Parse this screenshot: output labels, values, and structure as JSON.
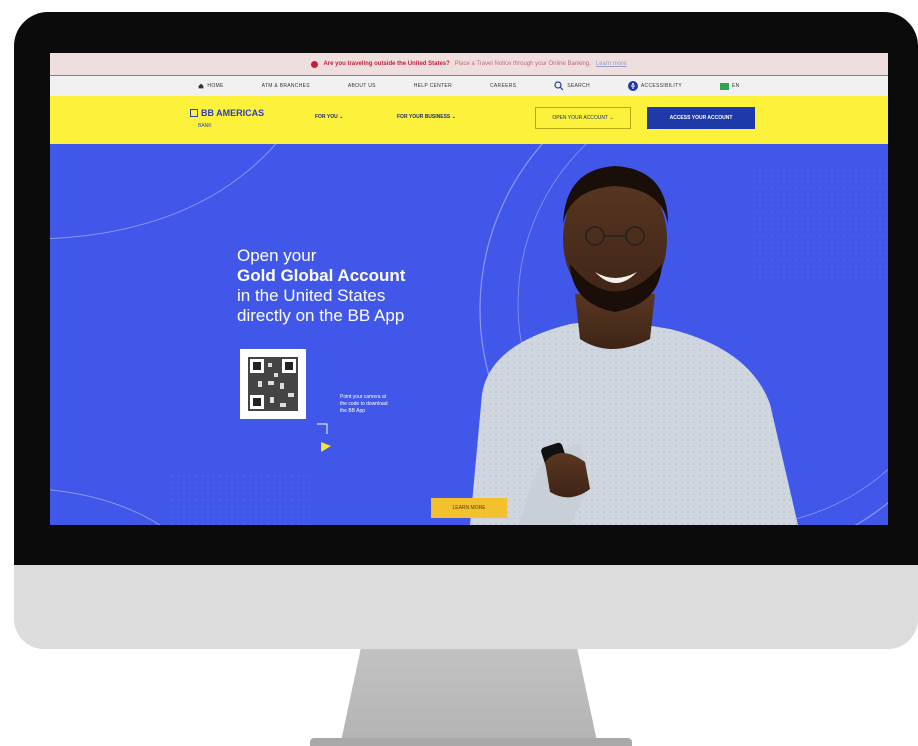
{
  "alert": {
    "bold_text": "Are you traveling outside the United States?",
    "text": "Place a Travel Notice through your Online Banking.",
    "link": "Learn more"
  },
  "util_nav": {
    "items": [
      "HOME",
      "ATM & BRANCHES",
      "ABOUT US",
      "HELP CENTER",
      "CAREERS",
      "SEARCH",
      "ACCESSIBILITY",
      "EN"
    ]
  },
  "header": {
    "logo": "BB AMERICAS",
    "logo_sub": "BANK",
    "nav": [
      "FOR YOU",
      "FOR YOUR BUSINESS"
    ],
    "open_account": "OPEN YOUR ACCOUNT",
    "access_account": "ACCESS YOUR ACCOUNT"
  },
  "hero": {
    "line1": "Open your",
    "line2": "Gold Global Account",
    "line3": "in the United States",
    "line4": "directly on the BB App",
    "qr_hint": "Point your camera at the code to download the BB App",
    "cta": "LEARN MORE"
  },
  "colors": {
    "hero_bg": "#4157ea",
    "header_bg": "#fcf23b",
    "primary_button": "#1d3aa8",
    "cta": "#f3c02e",
    "alert": "#c0213b"
  }
}
